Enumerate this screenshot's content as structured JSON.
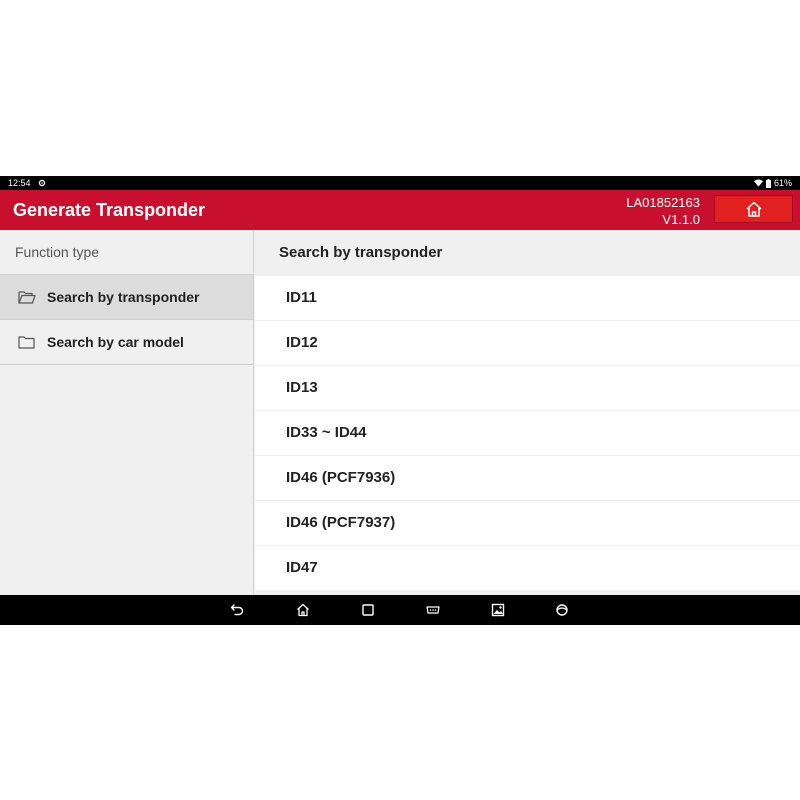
{
  "status_bar": {
    "time": "12:54",
    "battery": "61%"
  },
  "header": {
    "title": "Generate Transponder",
    "serial": "LA01852163",
    "version": "V1.1.0"
  },
  "sidebar": {
    "title": "Function type",
    "items": [
      {
        "label": "Search by transponder",
        "selected": true
      },
      {
        "label": "Search by car model",
        "selected": false
      }
    ]
  },
  "main": {
    "title": "Search by transponder",
    "items": [
      {
        "label": "ID11"
      },
      {
        "label": "ID12"
      },
      {
        "label": "ID13"
      },
      {
        "label": "ID33 ~ ID44"
      },
      {
        "label": "ID46 (PCF7936)"
      },
      {
        "label": "ID46 (PCF7937)"
      },
      {
        "label": "ID47"
      }
    ]
  },
  "colors": {
    "header_bg": "#c8102e",
    "home_button_bg": "#e1211f",
    "selected_item_bg": "#dcdcdc"
  }
}
